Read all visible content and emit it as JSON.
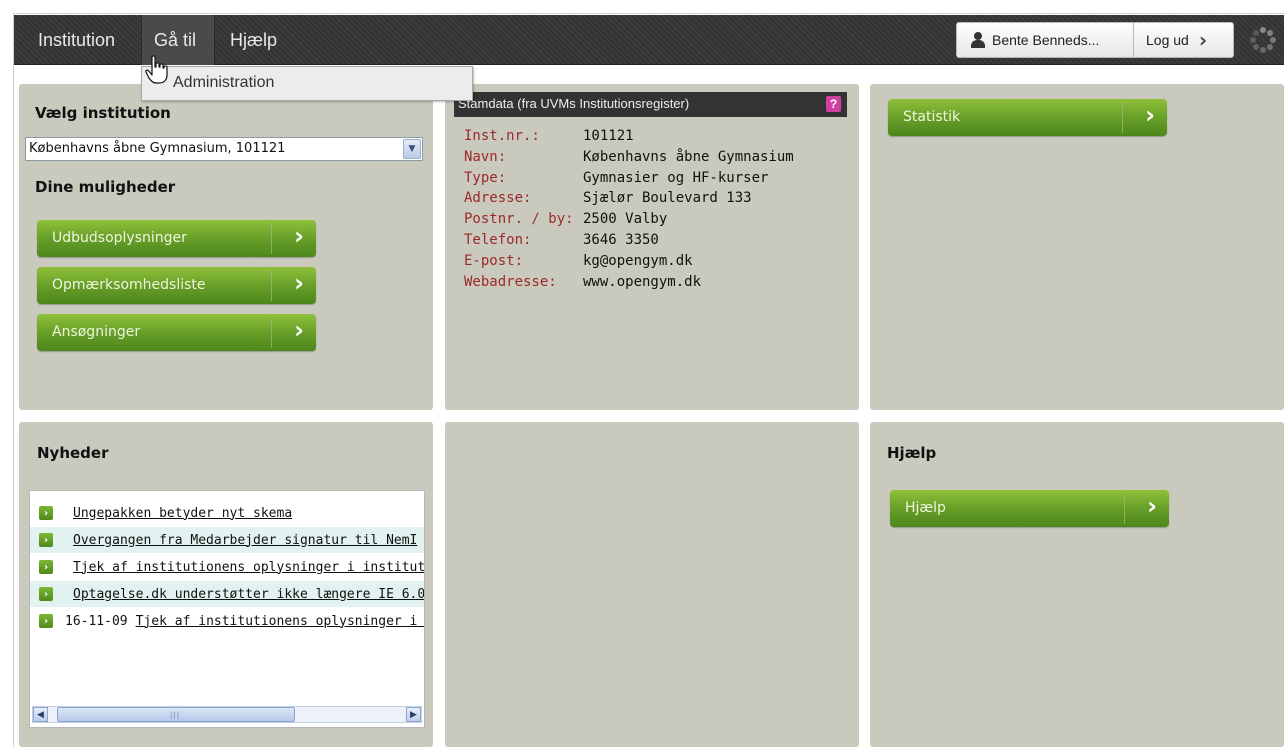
{
  "topbar": {
    "menu": [
      "Institution",
      "Gå til",
      "Hjælp"
    ],
    "user": "Bente Benneds...",
    "logout": "Log ud"
  },
  "dropdown": {
    "item": "Administration"
  },
  "institution_panel": {
    "heading": "Vælg institution",
    "selected": "Københavns åbne Gymnasium, 101121",
    "options_heading": "Dine muligheder",
    "buttons": [
      "Udbudsoplysninger",
      "Opmærksomhedsliste",
      "Ansøgninger"
    ]
  },
  "stamdata": {
    "title": "Stamdata (fra UVMs Institutionsregister)",
    "rows": [
      {
        "k": "Inst.nr.:",
        "v": "101121"
      },
      {
        "k": "Navn:",
        "v": "Københavns åbne Gymnasium"
      },
      {
        "k": "Type:",
        "v": "Gymnasier og HF-kurser"
      },
      {
        "k": "Adresse:",
        "v": "Sjælør Boulevard 133"
      },
      {
        "k": "Postnr. / by:",
        "v": "2500 Valby"
      },
      {
        "k": "Telefon:",
        "v": "3646 3350"
      },
      {
        "k": "E-post:",
        "v": "kg@opengym.dk"
      },
      {
        "k": "Webadresse:",
        "v": "www.opengym.dk"
      }
    ]
  },
  "statistik": {
    "button": "Statistik"
  },
  "news": {
    "heading": "Nyheder",
    "items": [
      {
        "date": "",
        "title": "Ungepakken betyder nyt skema"
      },
      {
        "date": "",
        "title": "Overgangen fra Medarbejder signatur til NemI"
      },
      {
        "date": "",
        "title": "Tjek af institutionens oplysninger i institutionsr"
      },
      {
        "date": "",
        "title": "Optagelse.dk understøtter ikke længere IE 6.0"
      },
      {
        "date": "16-11-09",
        "title": "Tjek af institutionens oplysninger i in:"
      }
    ]
  },
  "help": {
    "heading": "Hjælp",
    "button": "Hjælp"
  }
}
